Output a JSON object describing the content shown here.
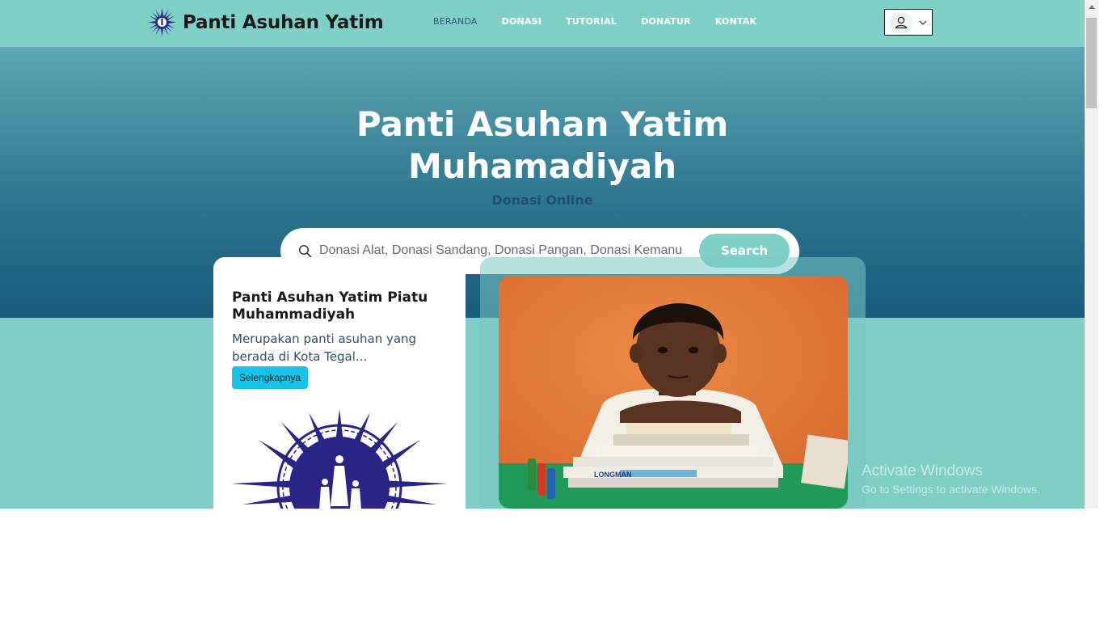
{
  "header": {
    "brand_name": "Panti Asuhan Yatim",
    "logo_icon": "muhammadiyah-sun-icon",
    "nav": [
      {
        "label": "BERANDA",
        "active": true
      },
      {
        "label": "DONASI",
        "active": false
      },
      {
        "label": "TUTORIAL",
        "active": false
      },
      {
        "label": "DONATUR",
        "active": false
      },
      {
        "label": "KONTAK",
        "active": false
      }
    ],
    "user_icon": "user-icon",
    "dropdown_icon": "chevron-down-icon"
  },
  "hero": {
    "title_line1": "Panti Asuhan Yatim",
    "title_line2": "Muhamadiyah",
    "subtitle": "Donasi Online",
    "search": {
      "placeholder": "Donasi Alat, Donasi Sandang, Donasi Pangan, Donasi Kemanusiaan",
      "button_label": "Search"
    }
  },
  "info_card": {
    "title": "Panti Asuhan Yatim Piatu Muhammadiyah",
    "description": "Merupakan panti asuhan yang berada di Kota Tegal...",
    "button_label": "Selengkapnya"
  },
  "photo_card": {
    "image": "child-with-books-photo",
    "book_spine_text": "LONGMAN"
  },
  "watermark": {
    "title": "Activate Windows",
    "subtitle": "Go to Settings to activate Windows."
  },
  "colors": {
    "header_bg": "#7fd0c6",
    "hero_dark": "#195b7d",
    "accent": "#7fd0c6",
    "card_button": "#19c3e6"
  }
}
